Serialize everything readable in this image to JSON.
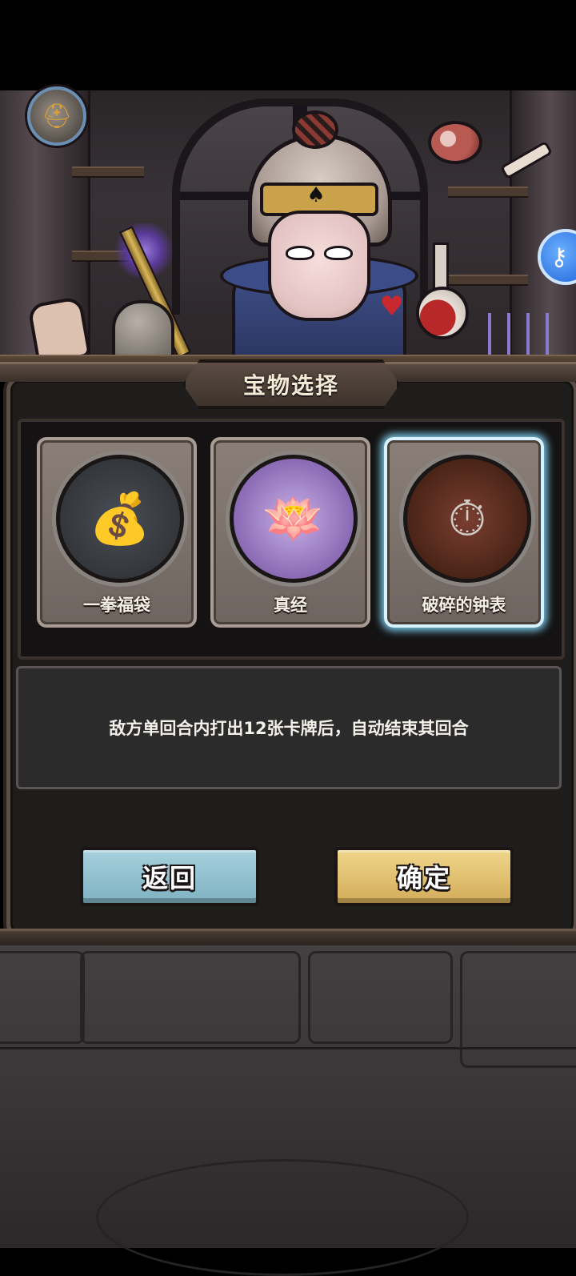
{
  "modal": {
    "title": "宝物选择",
    "description": "敌方单回合内打出12张卡牌后，自动结束其回合"
  },
  "treasures": [
    {
      "name": "一拳福袋",
      "icon": "fist-sack-icon",
      "selected": false
    },
    {
      "name": "真经",
      "icon": "fire-lotus-icon",
      "selected": false
    },
    {
      "name": "破碎的钟表",
      "icon": "broken-pocket-watch-icon",
      "selected": true
    }
  ],
  "buttons": {
    "back_label": "返回",
    "confirm_label": "确定"
  },
  "colors": {
    "selection_glow": "#78c8e6",
    "back_button": "#9dc8d6",
    "confirm_button": "#e8c877"
  }
}
